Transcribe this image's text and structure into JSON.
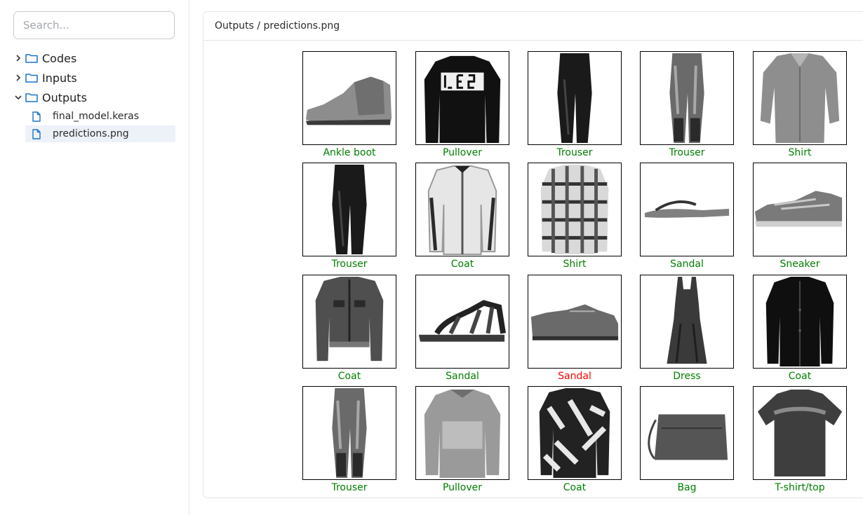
{
  "sidebar": {
    "search": {
      "placeholder": "Search..."
    },
    "folders": [
      {
        "label": "Codes",
        "expanded": false
      },
      {
        "label": "Inputs",
        "expanded": false
      },
      {
        "label": "Outputs",
        "expanded": true
      }
    ],
    "files": [
      {
        "label": "final_model.keras",
        "active": false
      },
      {
        "label": "predictions.png",
        "active": true
      }
    ]
  },
  "panel": {
    "breadcrumb": "Outputs / predictions.png"
  },
  "colors": {
    "correct": "#008000",
    "wrong": "#ff0000",
    "accent": "#1a73c9"
  },
  "predictions": [
    {
      "label": "Ankle boot",
      "correct": true,
      "item": "boot"
    },
    {
      "label": "Pullover",
      "correct": true,
      "item": "pullover-logo"
    },
    {
      "label": "Trouser",
      "correct": true,
      "item": "trouser-dark"
    },
    {
      "label": "Trouser",
      "correct": true,
      "item": "trouser-light"
    },
    {
      "label": "Shirt",
      "correct": true,
      "item": "shirt-gray"
    },
    {
      "label": "Trouser",
      "correct": true,
      "item": "trouser-dark"
    },
    {
      "label": "Coat",
      "correct": true,
      "item": "coat-light"
    },
    {
      "label": "Shirt",
      "correct": true,
      "item": "shirt-plaid"
    },
    {
      "label": "Sandal",
      "correct": true,
      "item": "flipflop"
    },
    {
      "label": "Sneaker",
      "correct": true,
      "item": "sneaker"
    },
    {
      "label": "Coat",
      "correct": true,
      "item": "jacket-denim"
    },
    {
      "label": "Sandal",
      "correct": true,
      "item": "sandal-strappy"
    },
    {
      "label": "Sandal",
      "correct": false,
      "item": "shoe-low"
    },
    {
      "label": "Dress",
      "correct": true,
      "item": "dress"
    },
    {
      "label": "Coat",
      "correct": true,
      "item": "coat-black"
    },
    {
      "label": "Trouser",
      "correct": true,
      "item": "trouser-light"
    },
    {
      "label": "Pullover",
      "correct": true,
      "item": "pullover-gray"
    },
    {
      "label": "Coat",
      "correct": true,
      "item": "coat-pattern"
    },
    {
      "label": "Bag",
      "correct": true,
      "item": "bag"
    },
    {
      "label": "T-shirt/top",
      "correct": true,
      "item": "tshirt"
    }
  ]
}
